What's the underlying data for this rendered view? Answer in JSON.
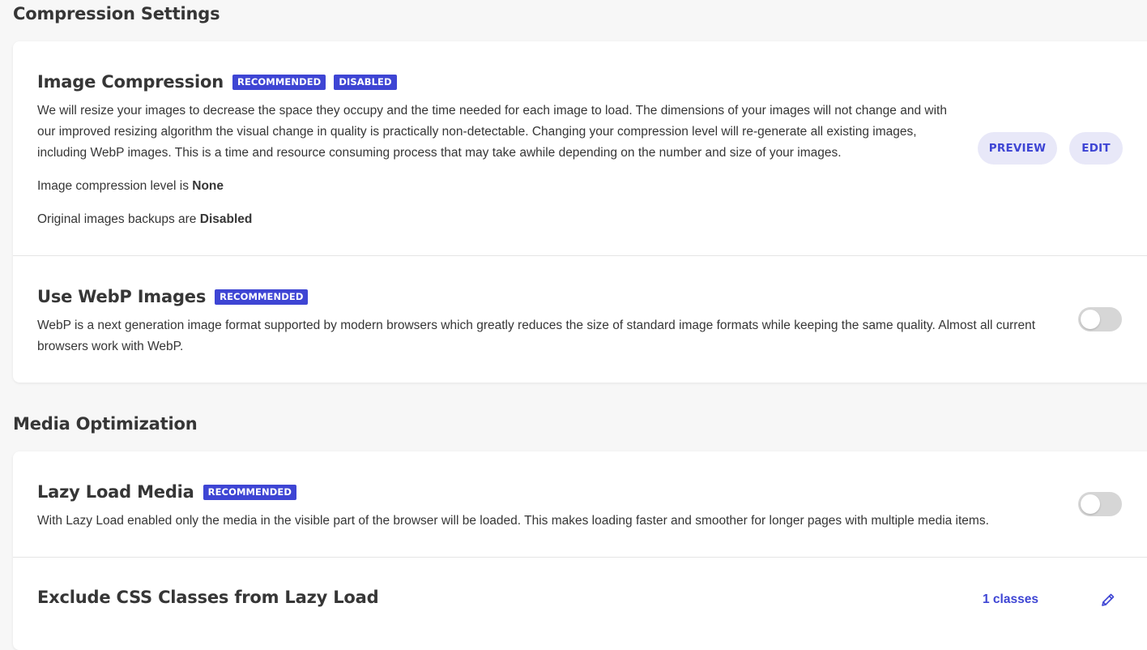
{
  "sections": {
    "compression": {
      "title": "Compression Settings"
    },
    "media": {
      "title": "Media Optimization"
    }
  },
  "image_compression": {
    "title": "Image Compression",
    "badge_recommended": "RECOMMENDED",
    "badge_status": "DISABLED",
    "description": "We will resize your images to decrease the space they occupy and the time needed for each image to load. The dimensions of your images will not change and with our improved resizing algorithm the visual change in quality is practically non-detectable. Changing your compression level will re-generate all existing images, including WebP images. This is a time and resource consuming process that may take awhile depending on the number and size of your images.",
    "level_label": "Image compression level is ",
    "level_value": "None",
    "backup_label": "Original images backups are ",
    "backup_value": "Disabled",
    "preview_button": "PREVIEW",
    "edit_button": "EDIT"
  },
  "webp": {
    "title": "Use WebP Images",
    "badge_recommended": "RECOMMENDED",
    "description": "WebP is a next generation image format supported by modern browsers which greatly reduces the size of standard image formats while keeping the same quality. Almost all current browsers work with WebP.",
    "enabled": false
  },
  "lazy_load": {
    "title": "Lazy Load Media",
    "badge_recommended": "RECOMMENDED",
    "description": "With Lazy Load enabled only the media in the visible part of the browser will be loaded. This makes loading faster and smoother for longer pages with multiple media items.",
    "enabled": false
  },
  "exclude_css": {
    "title": "Exclude CSS Classes from Lazy Load",
    "count_label": "1 classes"
  },
  "colors": {
    "accent": "#3e45d4",
    "button_bg": "#e8e8f8",
    "toggle_off": "#d6d6d6",
    "page_bg": "#f7f7f7"
  },
  "icons": {
    "edit": "pencil-icon"
  }
}
